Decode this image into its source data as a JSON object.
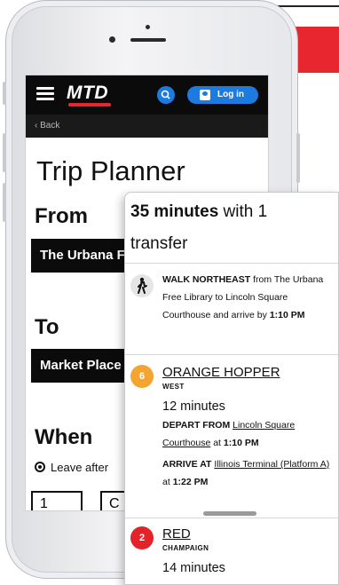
{
  "colors": {
    "brand_red": "#e8262f",
    "nav_black": "#0b0b0b",
    "accent_blue": "#1d7be0",
    "orange": "#f3a530",
    "red_route": "#e4222a"
  },
  "app": {
    "logo": "MTD",
    "login_label": "Log in",
    "back_label": "‹ Back",
    "menu_icon": "hamburger-icon",
    "search_icon": "search-icon",
    "user_icon": "user-icon"
  },
  "planner": {
    "title": "Trip Planner",
    "from_label": "From",
    "from_value": "The Urbana Free Library",
    "to_label": "To",
    "to_value": "Market Place",
    "when_label": "When",
    "leave_option": "Leave after",
    "time_hour": "1",
    "time_min": "C"
  },
  "result": {
    "summary_duration": "35 minutes",
    "summary_rest": " with 1",
    "summary_line2": "transfer",
    "walk": {
      "icon": "walking-person-icon",
      "caps": "WALK NORTHEAST",
      "text": " from The Urbana Free Library to Lincoln Square Courthouse and arrive by ",
      "time": "1:10 PM"
    },
    "legs": [
      {
        "number": "6",
        "route": "ORANGE HOPPER",
        "direction": "WEST",
        "duration": "12 minutes",
        "depart_caps": "DEPART FROM",
        "depart_stop": "Lincoln Square Courthouse",
        "depart_time": "1:10 PM",
        "arrive_caps": "ARRIVE AT",
        "arrive_stop": "Illinois Terminal (Platform A)",
        "arrive_time": "1:22 PM"
      },
      {
        "number": "2",
        "route": "RED",
        "direction": "CHAMPAIGN",
        "duration": "14 minutes"
      }
    ],
    "at_word": "at"
  }
}
